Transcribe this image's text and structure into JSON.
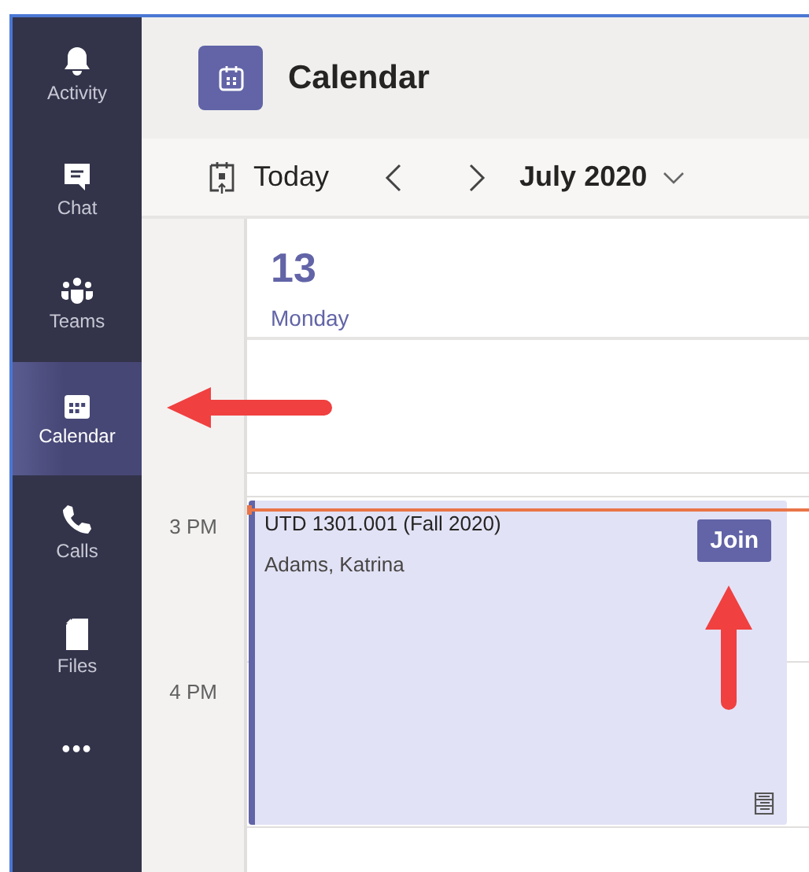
{
  "rail": {
    "items": [
      {
        "label": "Activity",
        "kind": "bell",
        "selected": false
      },
      {
        "label": "Chat",
        "kind": "chat",
        "selected": false
      },
      {
        "label": "Teams",
        "kind": "teams",
        "selected": false
      },
      {
        "label": "Calendar",
        "kind": "calendar",
        "selected": true
      },
      {
        "label": "Calls",
        "kind": "phone",
        "selected": false
      },
      {
        "label": "Files",
        "kind": "file",
        "selected": false
      }
    ],
    "more": "•••"
  },
  "header": {
    "title": "Calendar"
  },
  "toolbar": {
    "today": "Today",
    "month": "July 2020"
  },
  "day": {
    "number": "13",
    "weekday": "Monday"
  },
  "times": [
    "3 PM",
    "4 PM"
  ],
  "events": [
    {
      "title": "UTD 1301.001 (Fall 2020)",
      "organizer": "Adams, Katrina",
      "join": "Join"
    }
  ]
}
